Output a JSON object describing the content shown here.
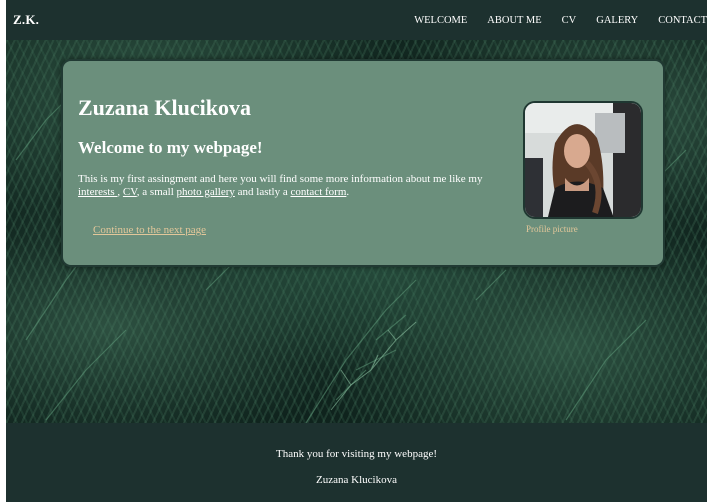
{
  "header": {
    "brand": "Z.K.",
    "nav": [
      "WELCOME",
      "ABOUT ME",
      "CV",
      "GALERY",
      "CONTACT"
    ]
  },
  "card": {
    "title": "Zuzana Klucikova",
    "subtitle": "Welcome to my webpage!",
    "intro_start": "This is my first assingment and here you will find some more information about me like my ",
    "link_interests": "interests ",
    "sep1": ", ",
    "link_cv": "CV",
    "sep2": ", a small ",
    "link_gallery": "photo gallery",
    "sep3": " and lastly a ",
    "link_contact": "contact form",
    "intro_end": ".",
    "next_link": "Continue to the next page",
    "photo_caption": "Profile picture"
  },
  "footer": {
    "thanks": "Thank you for visiting my webpage!",
    "name": "Zuzana Klucikova"
  },
  "colors": {
    "header_bg": "#1d312f",
    "card_bg": "#6b8f7c",
    "link_accent": "#e3c79a"
  }
}
